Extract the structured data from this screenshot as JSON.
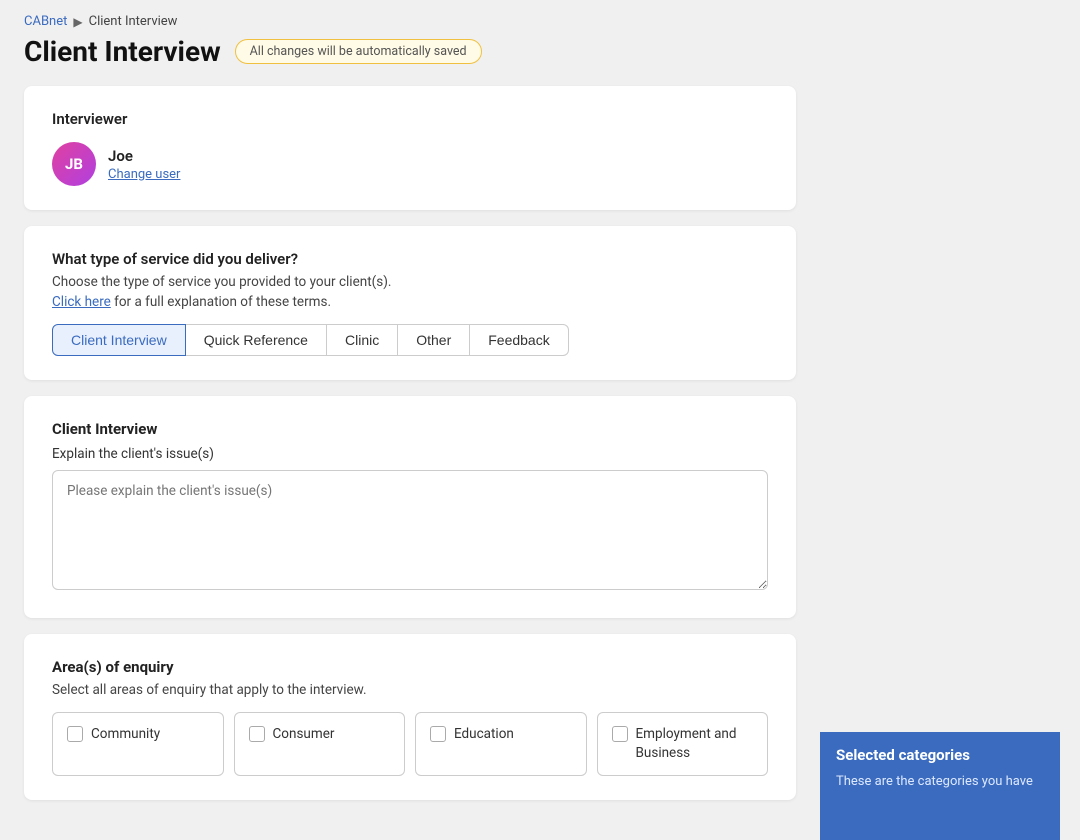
{
  "breadcrumb": {
    "link_label": "CABnet",
    "separator": "▶",
    "current": "Client Interview"
  },
  "page_title": "Client Interview",
  "autosave_text": "All changes will be automatically saved",
  "interviewer_section": {
    "label": "Interviewer",
    "avatar_initials": "JB",
    "name": "Joe",
    "change_user_label": "Change user"
  },
  "service_section": {
    "question": "What type of service did you deliver?",
    "sub_text": "Choose the type of service you provided to your client(s).",
    "link_text": "Click here",
    "link_suffix": " for a full explanation of these terms.",
    "tabs": [
      {
        "label": "Client Interview",
        "active": true
      },
      {
        "label": "Quick Reference",
        "active": false
      },
      {
        "label": "Clinic",
        "active": false
      },
      {
        "label": "Other",
        "active": false
      },
      {
        "label": "Feedback",
        "active": false
      }
    ]
  },
  "client_interview_section": {
    "title": "Client Interview",
    "field_label": "Explain the client's issue(s)",
    "textarea_placeholder": "Please explain the client's issue(s)"
  },
  "areas_section": {
    "title": "Area(s) of enquiry",
    "sub_text": "Select all areas of enquiry that apply to the interview.",
    "categories": [
      {
        "label": "Community"
      },
      {
        "label": "Consumer"
      },
      {
        "label": "Education"
      },
      {
        "label": "Employment and Business"
      }
    ]
  },
  "selected_categories_panel": {
    "title": "Selected categories",
    "body_text": "These are the categories you have"
  }
}
